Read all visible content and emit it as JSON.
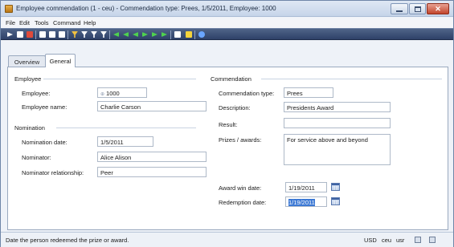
{
  "window": {
    "title": "Employee commendation (1 - ceu) - Commendation type: Prees, 1/5/2011, Employee: 1000"
  },
  "menu": [
    "File",
    "Edit",
    "Tools",
    "Command",
    "Help"
  ],
  "toolbar": {
    "icons": [
      {
        "name": "new-record-icon",
        "color": "#ffffff"
      },
      {
        "name": "save-icon",
        "color": "#ffffff"
      },
      {
        "name": "delete-icon",
        "color": "#e04a3a"
      },
      {
        "name": "print-icon",
        "color": "#ffffff"
      },
      {
        "name": "print-preview-icon",
        "color": "#ffffff"
      },
      {
        "name": "email-icon",
        "color": "#ffffff"
      },
      {
        "name": "filter-by-selection-icon",
        "color": "#f0c040"
      },
      {
        "name": "advanced-filter-icon",
        "color": "#ffffff"
      },
      {
        "name": "filter-by-field-icon",
        "color": "#ffffff"
      },
      {
        "name": "remove-filter-icon",
        "color": "#ffffff"
      },
      {
        "name": "first-record-icon",
        "color": "#4fd24f"
      },
      {
        "name": "previous-page-icon",
        "color": "#4fd24f"
      },
      {
        "name": "previous-record-icon",
        "color": "#4fd24f"
      },
      {
        "name": "next-record-icon",
        "color": "#4fd24f"
      },
      {
        "name": "next-page-icon",
        "color": "#4fd24f"
      },
      {
        "name": "last-record-icon",
        "color": "#4fd24f"
      },
      {
        "name": "document-handling-icon",
        "color": "#ffffff"
      },
      {
        "name": "alert-icon",
        "color": "#f5d33b"
      },
      {
        "name": "help-icon",
        "color": "#6aa6ff"
      }
    ]
  },
  "tabs": {
    "overview": "Overview",
    "general": "General"
  },
  "employee_group": {
    "title": "Employee",
    "employee_label": "Employee:",
    "employee_value": "1000",
    "employee_name_label": "Employee name:",
    "employee_name_value": "Charlie Carson"
  },
  "nomination_group": {
    "title": "Nomination",
    "date_label": "Nomination date:",
    "date_value": "1/5/2011",
    "nominator_label": "Nominator:",
    "nominator_value": "Alice Alison",
    "relationship_label": "Nominator relationship:",
    "relationship_value": "Peer"
  },
  "commendation_group": {
    "title": "Commendation",
    "type_label": "Commendation type:",
    "type_value": "Prees",
    "description_label": "Description:",
    "description_value": "Presidents Award",
    "result_label": "Result:",
    "result_value": "",
    "prizes_label": "Prizes / awards:",
    "prizes_value": "For service above and beyond",
    "award_win_date_label": "Award win date:",
    "award_win_date_value": "1/19/2011",
    "redemption_date_label": "Redemption date:",
    "redemption_date_value": "1/19/2011"
  },
  "statusbar": {
    "help_text": "Date the person redeemed the prize or award.",
    "currency": "USD",
    "company": "ceu",
    "user": "usr"
  }
}
